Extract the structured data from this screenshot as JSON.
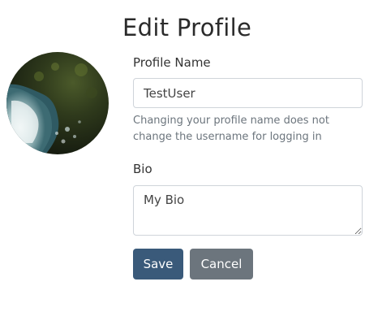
{
  "header": {
    "title": "Edit Profile"
  },
  "avatar": {
    "icon": "profile-photo-aerial-coast"
  },
  "form": {
    "profile_name": {
      "label": "Profile Name",
      "value": "TestUser",
      "help": "Changing your profile name does not change the username for logging in"
    },
    "bio": {
      "label": "Bio",
      "value": "My Bio"
    },
    "buttons": {
      "save_label": "Save",
      "cancel_label": "Cancel"
    }
  },
  "colors": {
    "save_button": "#3a5a7a",
    "cancel_button": "#6c757d",
    "input_border": "#cfd4da",
    "help_text": "#6c757d"
  }
}
